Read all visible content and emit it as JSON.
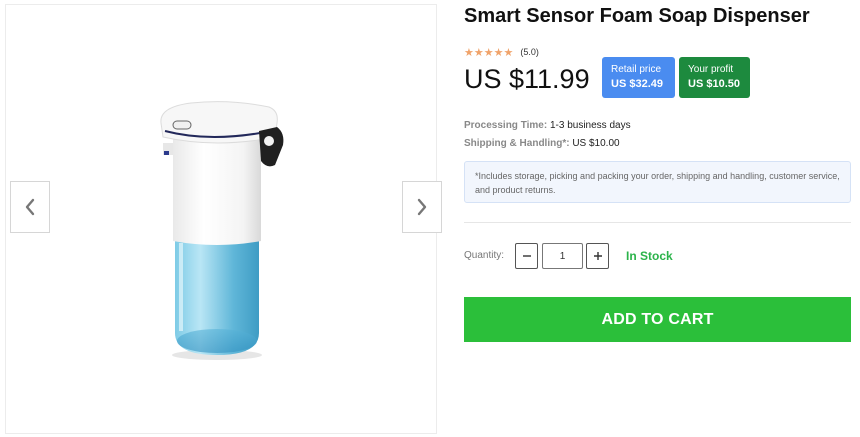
{
  "product": {
    "title": "Smart Sensor Foam Soap Dispenser",
    "rating_stars": 5,
    "rating_text": "(5.0)",
    "price": "US $11.99",
    "retail_label": "Retail price",
    "retail_value": "US $32.49",
    "profit_label": "Your profit",
    "profit_value": "US $10.50",
    "image_alt": "Smart Sensor Foam Soap Dispenser"
  },
  "details": {
    "processing_label": "Processing Time:",
    "processing_value": "1-3 business days",
    "shipping_label": "Shipping & Handling*:",
    "shipping_value": "US $10.00",
    "note": "*Includes storage, picking and packing your order, shipping and handling, customer service, and product returns."
  },
  "purchase": {
    "quantity_label": "Quantity:",
    "quantity_value": "1",
    "stock_status": "In Stock",
    "add_to_cart": "ADD TO CART"
  },
  "icons": {
    "prev": "chevron-left-icon",
    "next": "chevron-right-icon",
    "minus": "minus-icon",
    "plus": "plus-icon",
    "star": "star-icon"
  },
  "colors": {
    "retail_badge": "#4a8cf0",
    "profit_badge": "#1d8a3e",
    "stock_text": "#2bb34a",
    "cart_button": "#2bbf3a",
    "star": "#f0a36a"
  }
}
